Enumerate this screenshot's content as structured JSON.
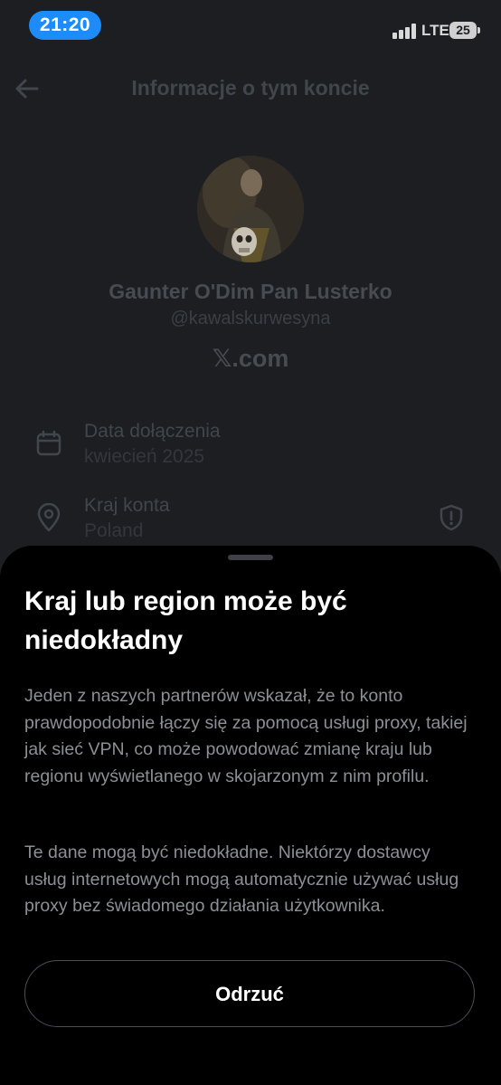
{
  "status_bar": {
    "time": "21:20",
    "network": "LTE",
    "battery": "25"
  },
  "header": {
    "title": "Informacje o tym koncie",
    "back_icon": "arrow-left-icon"
  },
  "profile": {
    "name": "Gaunter O'Dim Pan Lusterko",
    "handle": "@kawalskurwesyna",
    "platform": "𝕏.com"
  },
  "details": [
    {
      "icon": "calendar-icon",
      "label": "Data dołączenia",
      "value": "kwiecień 2025"
    },
    {
      "icon": "location-pin-icon",
      "label": "Kraj konta",
      "value": "Poland",
      "trailing_icon": "shield-alert-icon"
    }
  ],
  "sheet": {
    "title": "Kraj lub region może być niedokładny",
    "paragraph_1": "Jeden z naszych partnerów wskazał, że to konto prawdopodobnie łączy się za pomocą usługi proxy, takiej jak sieć VPN, co może powodować zmianę kraju lub regionu wyświetlanego w skojarzonym z nim profilu.",
    "paragraph_2": "Te dane mogą być niedokładne. Niektórzy dostawcy usług internetowych mogą automatycznie używać usług proxy bez świadomego działania użytkownika.",
    "dismiss_label": "Odrzuć"
  },
  "colors": {
    "accent": "#1d8cf8",
    "background": "#1c1e22",
    "sheet": "#000000"
  }
}
